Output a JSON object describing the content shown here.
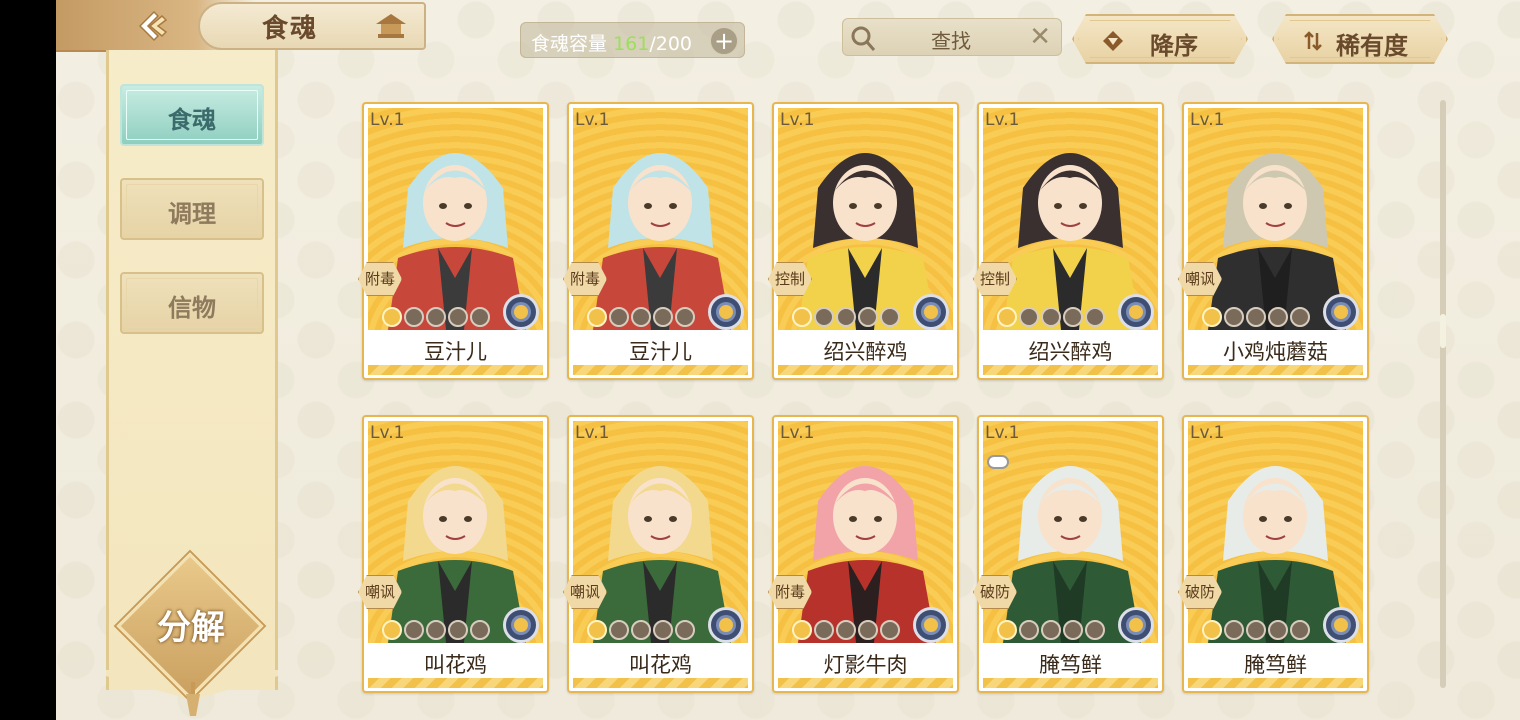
{
  "header": {
    "title": "食魂",
    "capacity_label": "食魂容量",
    "capacity_current": "161",
    "capacity_max": "/200",
    "capacity_add": "+",
    "search_placeholder": "查找",
    "search_clear": "✕",
    "sort_order_label": "降序",
    "sort_key_label": "稀有度"
  },
  "sidebar": {
    "tabs": [
      {
        "label": "食魂",
        "active": true
      },
      {
        "label": "调理",
        "active": false
      },
      {
        "label": "信物",
        "active": false
      }
    ],
    "decompose_label": "分解"
  },
  "cards": [
    {
      "level": "Lv.1",
      "tag": "附毒",
      "name": "豆汁儿",
      "stars": 1
    },
    {
      "level": "Lv.1",
      "tag": "附毒",
      "name": "豆汁儿",
      "stars": 1
    },
    {
      "level": "Lv.1",
      "tag": "控制",
      "name": "绍兴醉鸡",
      "stars": 1
    },
    {
      "level": "Lv.1",
      "tag": "控制",
      "name": "绍兴醉鸡",
      "stars": 1
    },
    {
      "level": "Lv.1",
      "tag": "嘲讽",
      "name": "小鸡炖蘑菇",
      "stars": 1
    },
    {
      "level": "Lv.1",
      "tag": "嘲讽",
      "name": "叫花鸡",
      "stars": 1
    },
    {
      "level": "Lv.1",
      "tag": "嘲讽",
      "name": "叫花鸡",
      "stars": 1
    },
    {
      "level": "Lv.1",
      "tag": "附毒",
      "name": "灯影牛肉",
      "stars": 1
    },
    {
      "level": "Lv.1",
      "tag": "破防",
      "name": "腌笃鲜",
      "stars": 1,
      "locked": true
    },
    {
      "level": "Lv.1",
      "tag": "破防",
      "name": "腌笃鲜",
      "stars": 1
    }
  ],
  "colors": {
    "card_border": "#e8b64f",
    "accent_tab": "#8fcfc0",
    "capacity_current": "#9be05a"
  }
}
